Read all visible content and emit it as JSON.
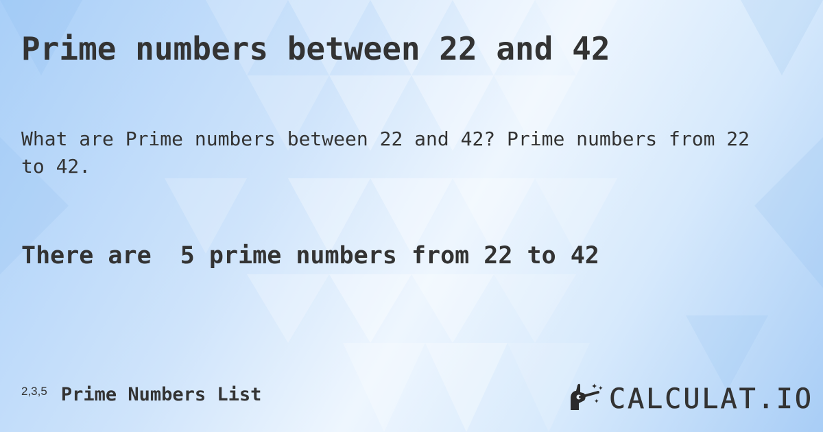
{
  "page": {
    "title": "Prime numbers between 22 and 42",
    "description": "What are Prime numbers between 22 and 42? Prime numbers from 22 to 42.",
    "result": "There are  5 prime numbers from 22 to 42"
  },
  "footer": {
    "link_prefix": "2,3,5",
    "link_label": "Prime Numbers List"
  },
  "logo": {
    "icon": "magic-hand-wand-icon",
    "text": "CALCULAT.IO"
  },
  "colors": {
    "text": "#333333",
    "background_light": "#eef6fe",
    "background_blue": "#a9cff8"
  }
}
